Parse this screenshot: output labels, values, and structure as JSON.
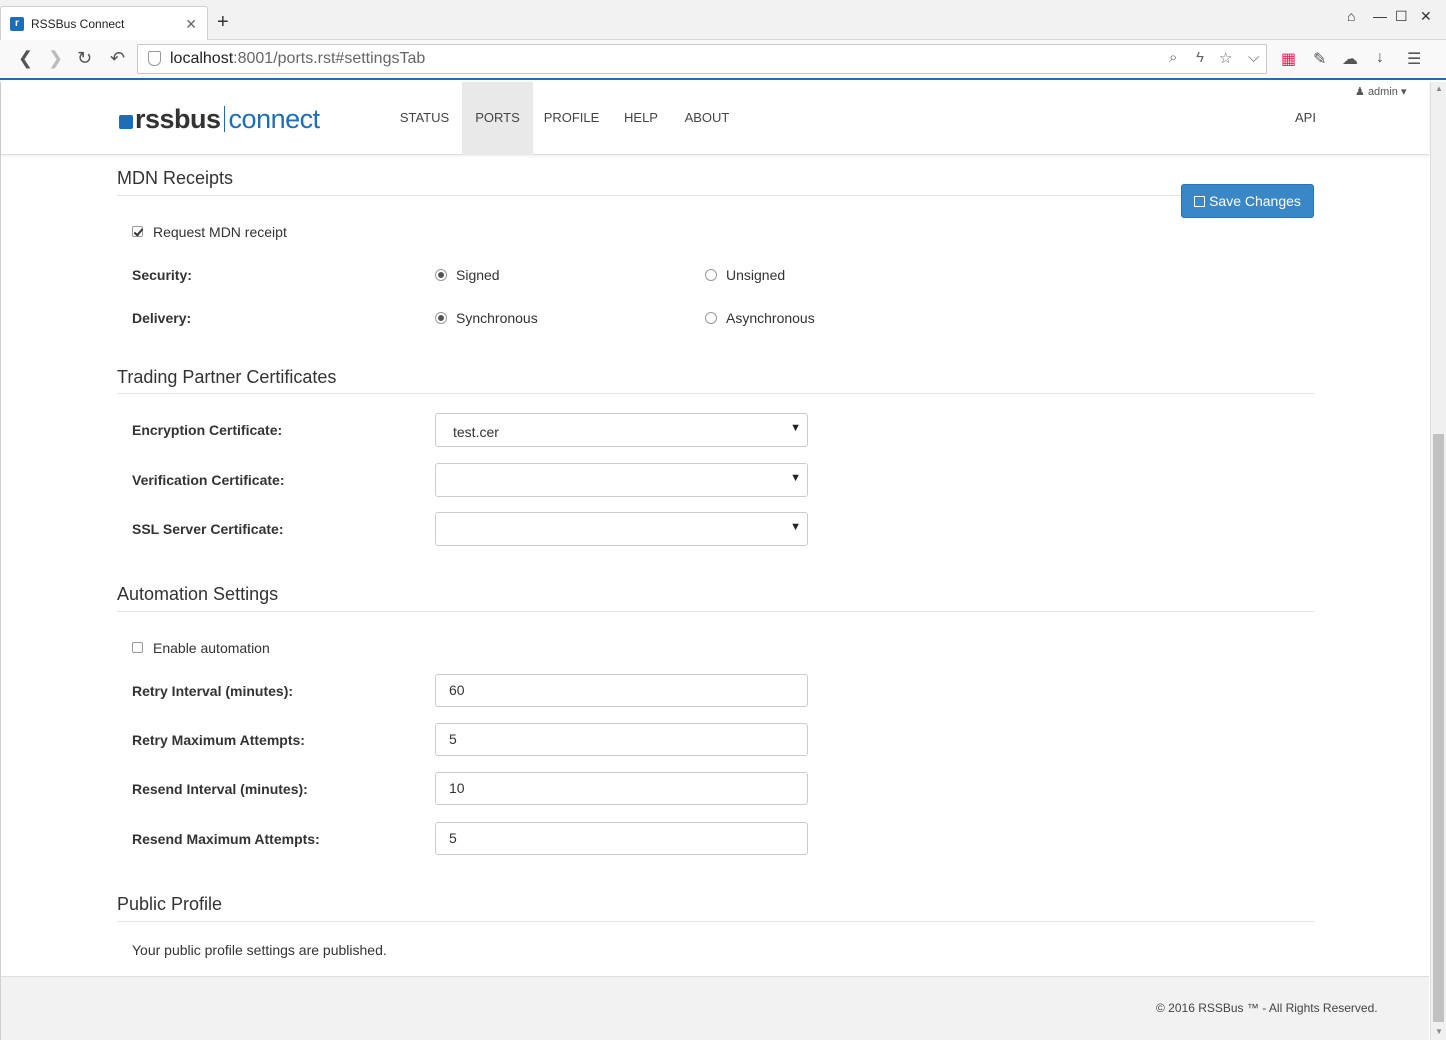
{
  "browser": {
    "tab_title": "RSSBus Connect",
    "tab_close": "✕",
    "new_tab": "+",
    "url_host": "localhost",
    "url_rest": ":8001/ports.rst#settingsTab"
  },
  "header": {
    "logo_rss": "rssbus",
    "logo_connect": "connect",
    "nav": [
      "STATUS",
      "PORTS",
      "PROFILE",
      "HELP",
      "ABOUT"
    ],
    "active_nav": "PORTS",
    "admin": "admin ▾",
    "api": "API"
  },
  "mdn": {
    "title": "MDN Receipts",
    "save_button": "Save Changes",
    "request_label": "Request MDN receipt",
    "request_checked": true,
    "security_label": "Security:",
    "security_options": [
      "Signed",
      "Unsigned"
    ],
    "security_selected": "Signed",
    "delivery_label": "Delivery:",
    "delivery_options": [
      "Synchronous",
      "Asynchronous"
    ],
    "delivery_selected": "Synchronous"
  },
  "certificates": {
    "title": "Trading Partner Certificates",
    "encryption_label": "Encryption Certificate:",
    "encryption_value": "test.cer",
    "verification_label": "Verification Certificate:",
    "verification_value": "",
    "ssl_label": "SSL Server Certificate:",
    "ssl_value": ""
  },
  "automation": {
    "title": "Automation Settings",
    "enable_label": "Enable automation",
    "enable_checked": false,
    "retry_interval_label": "Retry Interval (minutes):",
    "retry_interval_value": "60",
    "retry_max_label": "Retry Maximum Attempts:",
    "retry_max_value": "5",
    "resend_interval_label": "Resend Interval (minutes):",
    "resend_interval_value": "10",
    "resend_max_label": "Resend Maximum Attempts:",
    "resend_max_value": "5"
  },
  "public_profile": {
    "title": "Public Profile",
    "text": "Your public profile settings are published."
  },
  "footer": {
    "text": "© 2016 RSSBus ™ - All Rights Reserved."
  }
}
